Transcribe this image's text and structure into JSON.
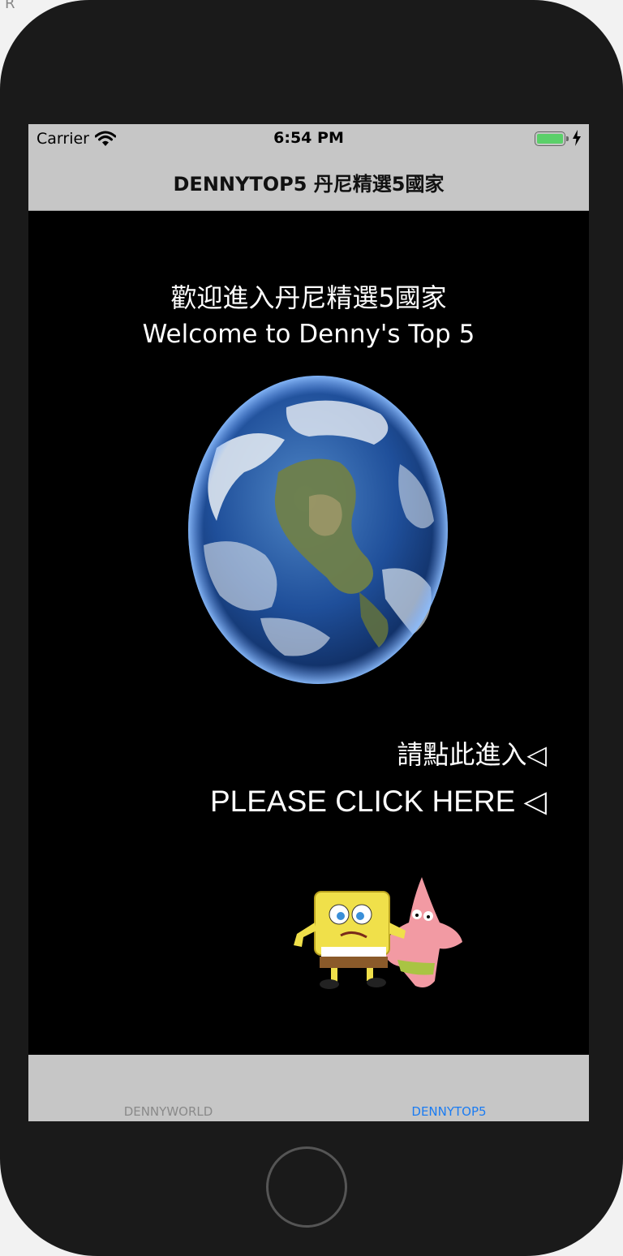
{
  "background": {
    "corner_text": "R"
  },
  "status_bar": {
    "carrier": "Carrier",
    "time": "6:54 PM",
    "battery_color": "#5bd06a"
  },
  "nav_bar": {
    "title": "DENNYTOP5 丹尼精選5國家"
  },
  "main": {
    "welcome_zh": "歡迎進入丹尼精選5國家",
    "welcome_en": "Welcome to Denny's Top 5",
    "earth_image": "earth-globe-image",
    "enter_zh": "請點此進入◁",
    "enter_en": "PLEASE CLICK HERE ◁",
    "cartoon_image": "spongebob-patrick-image"
  },
  "tab_bar": {
    "tabs": [
      {
        "label": "DENNYWORLD",
        "selected": false
      },
      {
        "label": "DENNYTOP5",
        "selected": true
      }
    ],
    "active_color": "#1b7cf2",
    "inactive_color": "#8a8a8a"
  }
}
